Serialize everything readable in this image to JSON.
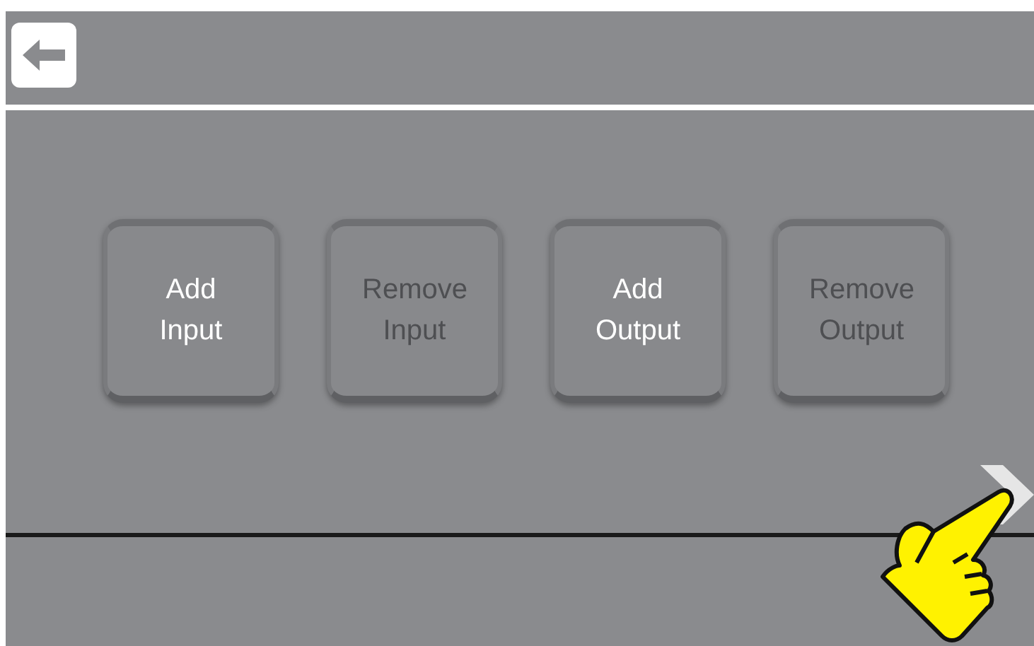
{
  "buttons": [
    {
      "label": "Add Input",
      "disabled": false
    },
    {
      "label": "Remove Input",
      "disabled": true
    },
    {
      "label": "Add Output",
      "disabled": false
    },
    {
      "label": "Remove Output",
      "disabled": true
    }
  ]
}
